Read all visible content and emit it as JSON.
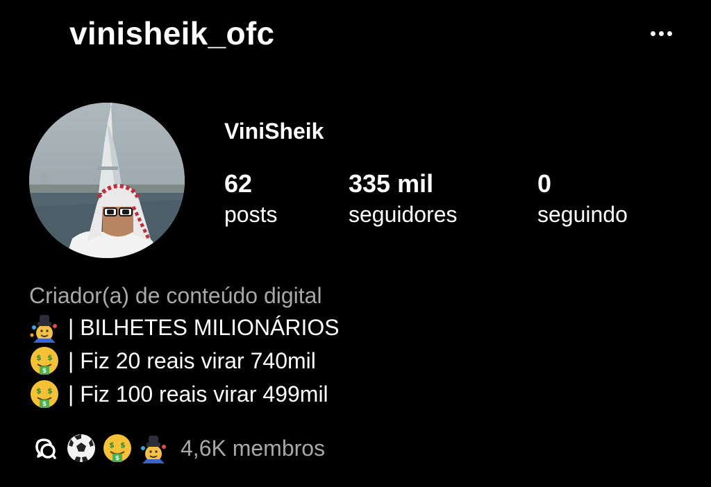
{
  "header": {
    "username": "vinisheik_ofc",
    "more_icon": "more-horizontal-icon"
  },
  "profile": {
    "display_name": "ViniSheik",
    "avatar": "profile-photo"
  },
  "stats": {
    "posts": {
      "value": "62",
      "label": "posts"
    },
    "followers": {
      "value": "335 mil",
      "label": "seguidores"
    },
    "following": {
      "value": "0",
      "label": "seguindo"
    }
  },
  "bio": {
    "category": "Criador(a) de conteúdo digital",
    "lines": [
      {
        "icon": "juggler-emoji",
        "text": "| BILHETES MILIONÁRIOS"
      },
      {
        "icon": "money-mouth-face-emoji",
        "text": "| Fiz 20 reais virar 740mil"
      },
      {
        "icon": "money-mouth-face-emoji",
        "text": "| Fiz 100 reais virar 499mil"
      }
    ]
  },
  "community": {
    "icons": [
      "threads-icon",
      "soccer-ball-emoji",
      "money-mouth-face-emoji",
      "juggler-emoji"
    ],
    "members": "4,6K membros"
  },
  "colors": {
    "background": "#000000",
    "text_primary": "#ffffff",
    "text_secondary": "#a8a8a8"
  }
}
